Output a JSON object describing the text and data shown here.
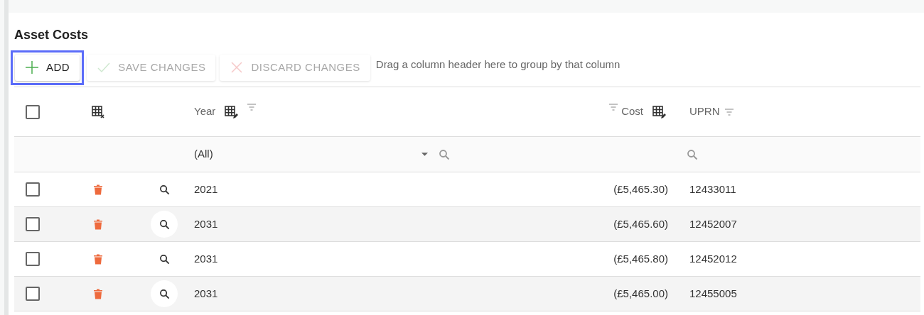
{
  "title": "Asset Costs",
  "toolbar": {
    "buttons": [
      {
        "kind": "add",
        "label": "ADD",
        "disabled": false,
        "focused": true
      },
      {
        "kind": "save",
        "label": "SAVE CHANGES",
        "disabled": true,
        "focused": false
      },
      {
        "kind": "discard",
        "label": "DISCARD CHANGES",
        "disabled": true,
        "focused": false
      }
    ],
    "group_hint": "Drag a column header here to group by that column"
  },
  "table": {
    "header_checkbox": {
      "checked": false
    },
    "columns": [
      {
        "label": "Year"
      },
      {
        "label": "Cost"
      },
      {
        "label": "UPRN"
      }
    ],
    "filters": {
      "year": "(All)"
    },
    "rows": [
      {
        "checked": false,
        "year": "2021",
        "cost": "(£5,465.30)",
        "uprn": "12433011"
      },
      {
        "checked": false,
        "year": "2031",
        "cost": "(£5,465.60)",
        "uprn": "12452007"
      },
      {
        "checked": false,
        "year": "2031",
        "cost": "(£5,465.80)",
        "uprn": "12452012"
      },
      {
        "checked": false,
        "year": "2031",
        "cost": "(£5,465.00)",
        "uprn": "12455005"
      }
    ]
  }
}
